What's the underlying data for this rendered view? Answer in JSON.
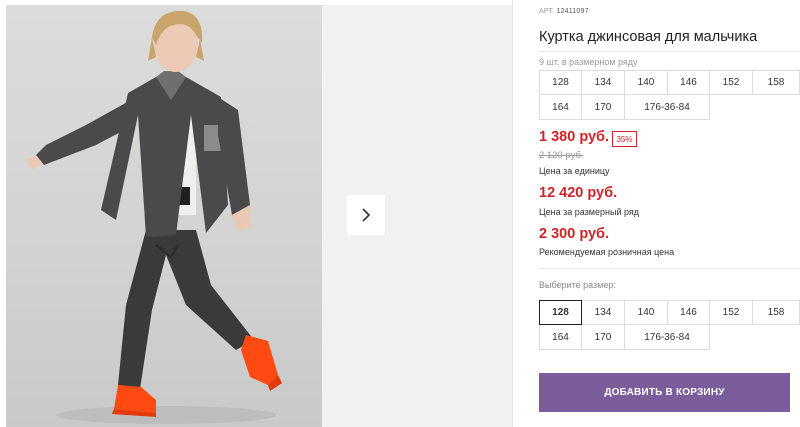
{
  "product": {
    "article_label": "АРТ.",
    "article_number": "12411097",
    "title": "Куртка джинсовая для мальчика",
    "size_row_note": "9 шт. в размерном ряду"
  },
  "size_row": [
    "128",
    "134",
    "140",
    "146",
    "152",
    "158",
    "164",
    "170",
    "176-36-84"
  ],
  "prices": {
    "current": "1 380 руб.",
    "discount": "35%",
    "old": "2 120 руб.",
    "unit_label": "Цена за единицу",
    "row_price": "12 420 руб.",
    "row_label": "Цена за размерный ряд",
    "retail_price": "2 300 руб.",
    "retail_label": "Рекомендуемая розничная цена"
  },
  "size_select": {
    "label": "Выберите размер:",
    "selected": "128",
    "options": [
      "128",
      "134",
      "140",
      "146",
      "152",
      "158",
      "164",
      "170",
      "176-36-84"
    ]
  },
  "cart": {
    "button_label": "ДОБАВИТЬ В КОРЗИНУ",
    "button_color": "#7c5d9c"
  },
  "gallery": {
    "next_icon": "chevron-right-icon"
  },
  "colors": {
    "price_red": "#d1232a",
    "sneaker_orange": "#ff4a12"
  }
}
